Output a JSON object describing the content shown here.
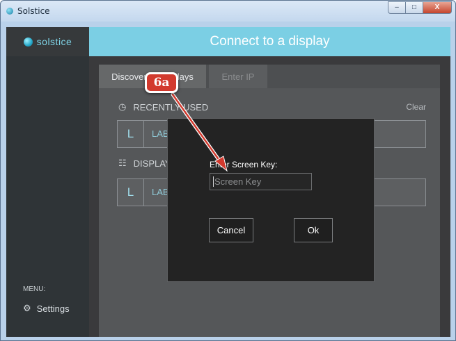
{
  "window": {
    "title": "Solstice",
    "icon": "solstice-logo-icon",
    "controls": {
      "minimize": "–",
      "maximize": "□",
      "close": "X"
    }
  },
  "app": {
    "logo_text": "solstice",
    "header_title": "Connect to a display",
    "accent_color": "#7bcfe4",
    "sidebar": {
      "menu_label": "MENU:",
      "settings_label": "Settings",
      "settings_icon": "gear-icon"
    },
    "tabs": [
      {
        "label": "Discovered Displays",
        "active": true
      },
      {
        "label": "Enter IP",
        "active": false
      }
    ],
    "recent": {
      "heading": "RECENTLY USED",
      "icon": "clock-icon",
      "clear_label": "Clear",
      "row": {
        "letter": "L",
        "label": "LAB"
      }
    },
    "displays": {
      "heading": "DISPLAYS",
      "icon": "network-icon",
      "row": {
        "letter": "L",
        "label": "LAB"
      }
    }
  },
  "dialog": {
    "label": "Enter Screen Key:",
    "input_value": "",
    "input_placeholder": "Screen Key",
    "cancel_label": "Cancel",
    "ok_label": "Ok"
  },
  "annotation": {
    "callout_text": "6a",
    "color": "#d23a2e"
  }
}
